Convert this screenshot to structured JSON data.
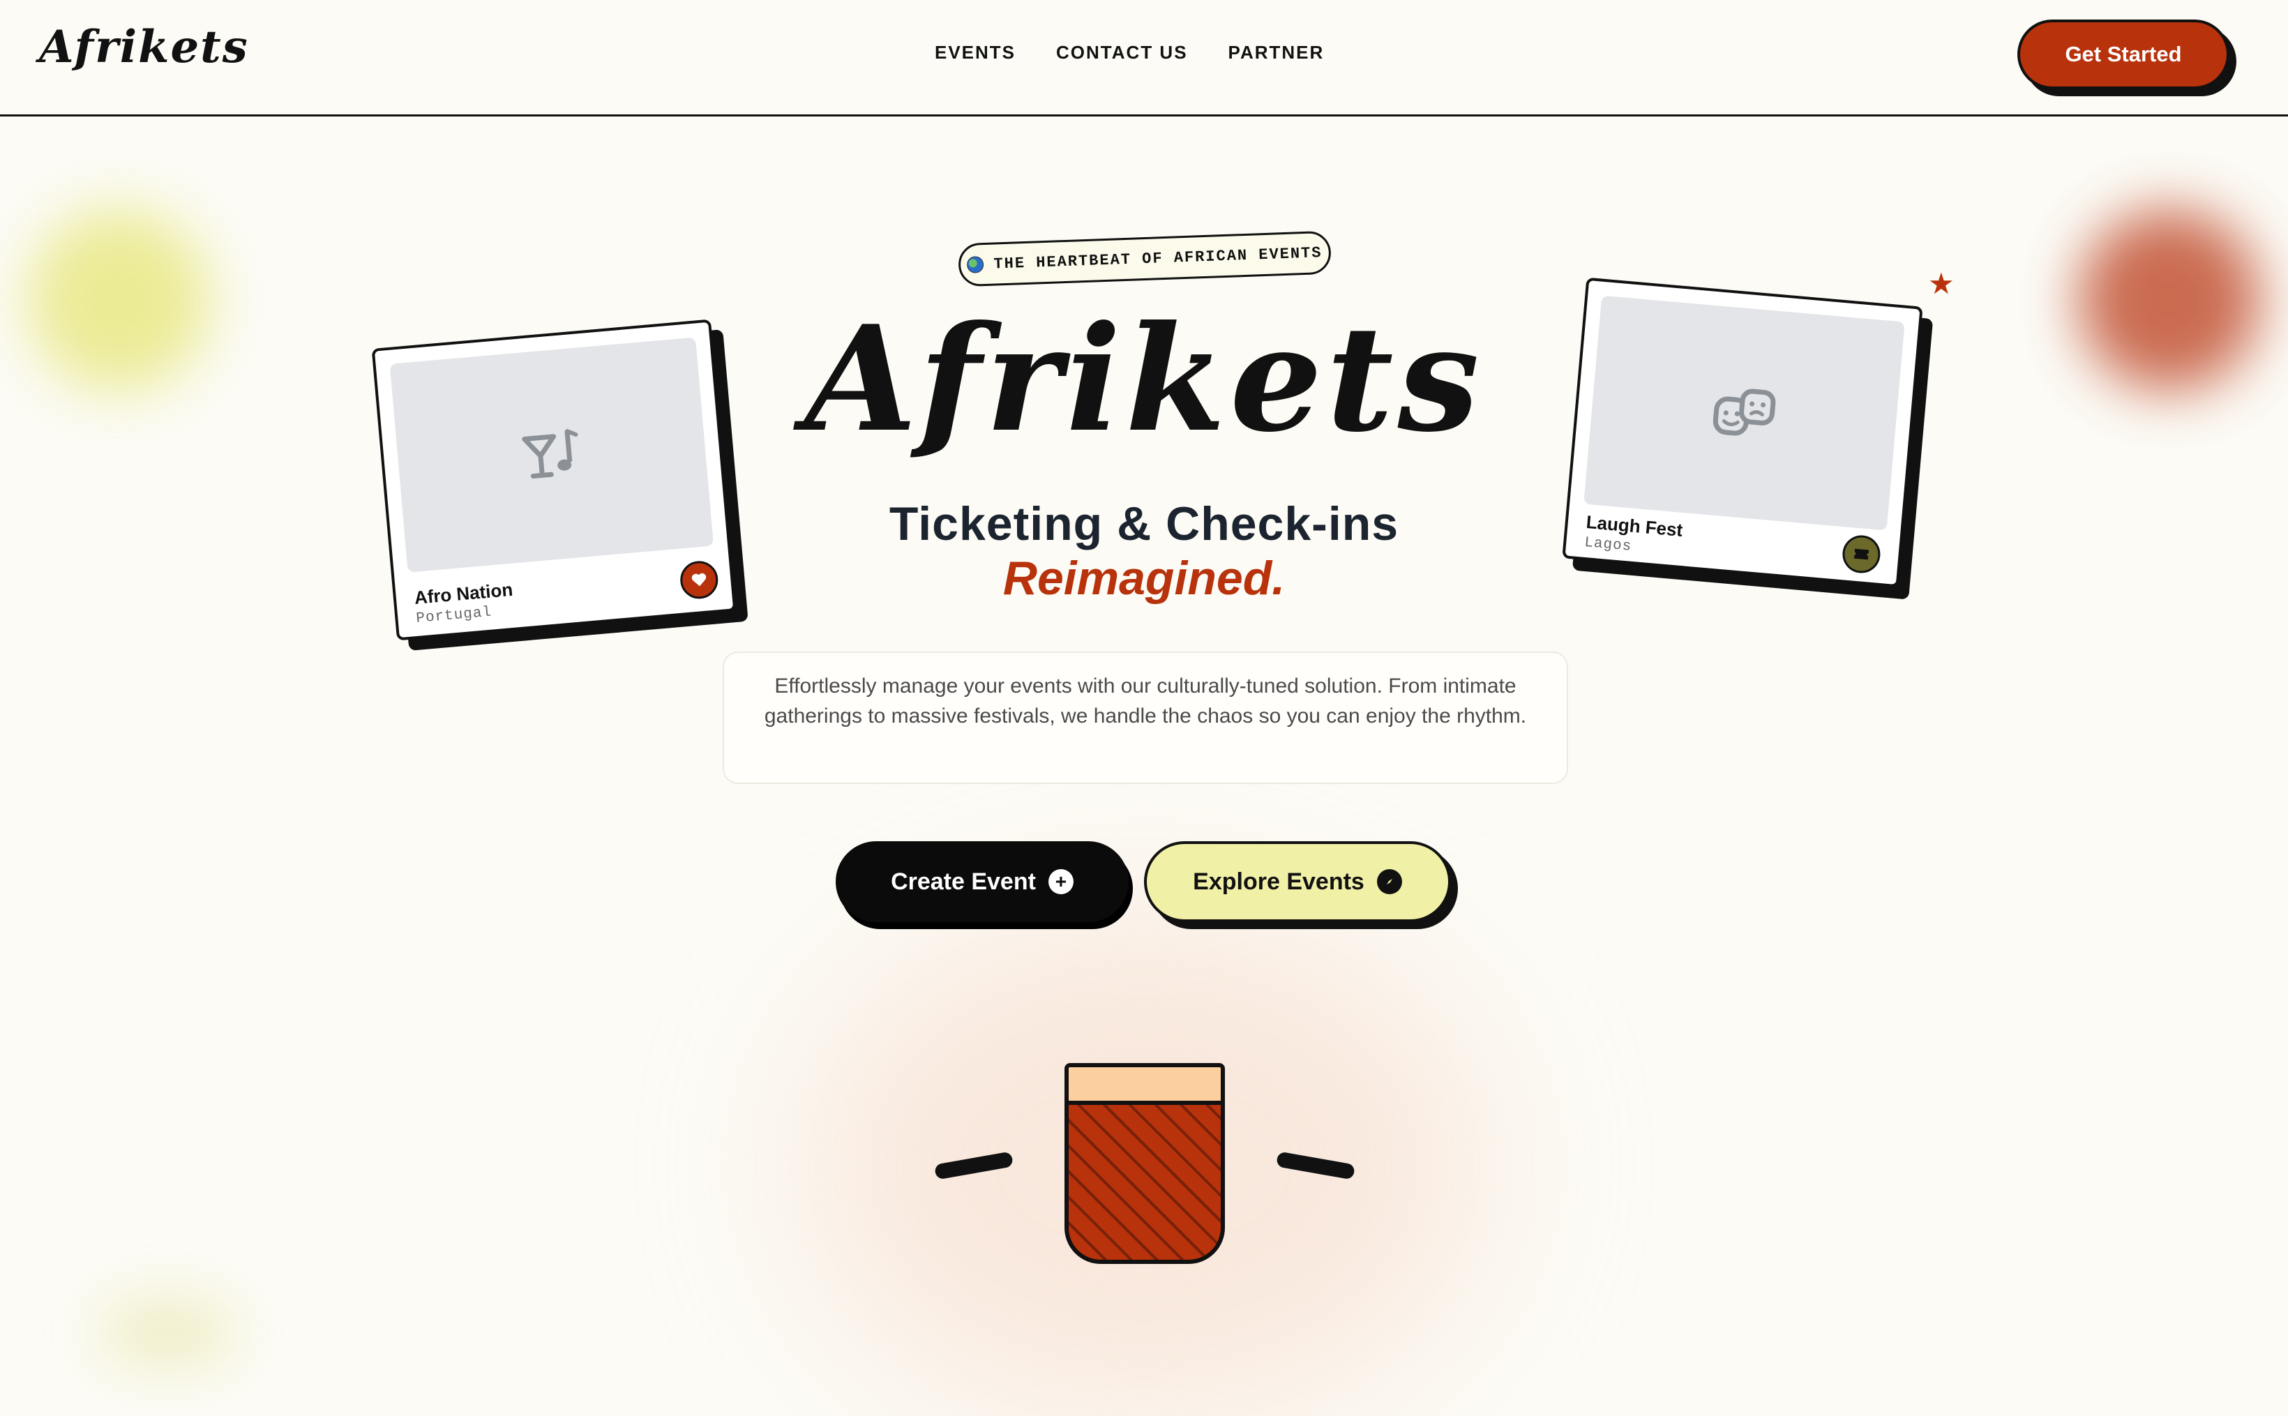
{
  "header": {
    "logo": "Afrikets",
    "nav": [
      "EVENTS",
      "CONTACT US",
      "PARTNER"
    ],
    "cta": "Get Started"
  },
  "hero": {
    "badge": "THE HEARTBEAT OF AFRICAN EVENTS",
    "title": "Afrikets",
    "tagline": "Ticketing & Check-ins",
    "tagline_accent": "Reimagined.",
    "description": "Effortlessly manage your events with our culturally-tuned solution. From intimate gatherings to massive festivals, we handle the chaos so you can enjoy the rhythm.",
    "primary_cta": "Create Event",
    "secondary_cta": "Explore Events"
  },
  "cards": [
    {
      "name": "Afro Nation",
      "location": "Portugal",
      "icon": "cocktail-music-icon",
      "badge_icon": "heart-icon",
      "badge_color": "#b8320c"
    },
    {
      "name": "Laugh Fest",
      "location": "Lagos",
      "icon": "theater-masks-icon",
      "badge_icon": "ticket-icon",
      "badge_color": "#6b6a2a"
    }
  ],
  "colors": {
    "accent": "#b8320c",
    "background": "#fcfbf5",
    "highlight": "#f1f0a7",
    "text": "#111111"
  }
}
